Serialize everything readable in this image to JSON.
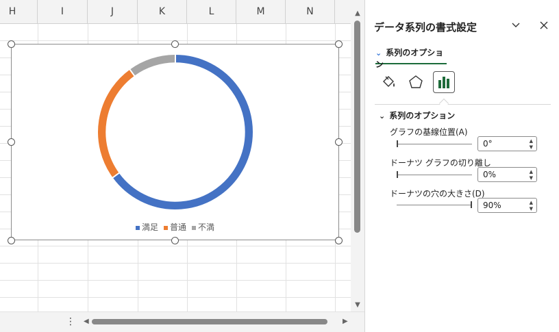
{
  "sheet": {
    "columns": [
      "H",
      "I",
      "J",
      "K",
      "L",
      "M",
      "N"
    ]
  },
  "chart_data": {
    "type": "pie",
    "categories": [
      "満足",
      "普通",
      "不満"
    ],
    "values": [
      0.65,
      0.25,
      0.1
    ],
    "series": [
      {
        "name": "満足",
        "color": "#4472c4"
      },
      {
        "name": "普通",
        "color": "#ed7d31"
      },
      {
        "name": "不満",
        "color": "#a5a5a5"
      }
    ],
    "donut_hole_percent": 90,
    "first_slice_angle_deg": 0,
    "legend_position": "bottom"
  },
  "hscroll": {
    "dots": "⋮",
    "left_arrow": "◀",
    "right_arrow": "▶"
  },
  "vscroll": {
    "up_arrow": "▲",
    "down_arrow": "▼"
  },
  "pane": {
    "title": "データ系列の書式設定",
    "collapse_icon": "chevron-down-icon",
    "close_icon": "close-icon",
    "tab_label": "系列のオプション",
    "icons": [
      "fill-bucket-icon",
      "pentagon-icon",
      "bar-chart-icon"
    ],
    "section_title": "系列のオプション",
    "fields": [
      {
        "label": "グラフの基線位置(A)",
        "value": "0°",
        "slider_fraction": 0.0
      },
      {
        "label": "ドーナツ グラフの切り離し",
        "value": "0%",
        "slider_fraction": 0.0
      },
      {
        "label": "ドーナツの穴の大きさ(D)",
        "value": "90%",
        "slider_fraction": 1.0
      }
    ]
  }
}
